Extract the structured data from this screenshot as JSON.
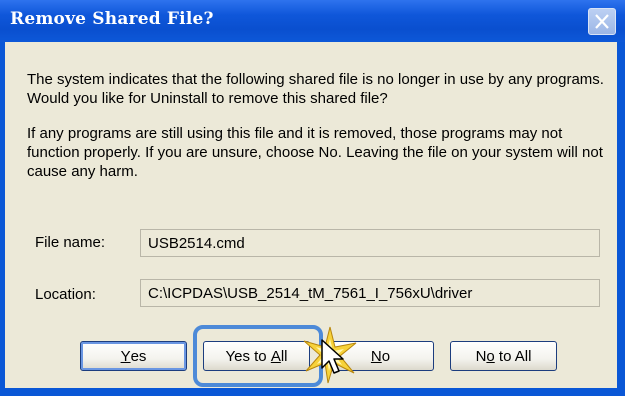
{
  "window": {
    "title": "Remove Shared File?",
    "close_icon": "close-icon"
  },
  "message": {
    "paragraph1": "The system indicates that the following shared file is no longer in use by any programs. Would you like for Uninstall to remove this shared file?",
    "paragraph2": "If any programs are still using this file and it is removed, those programs may not function properly. If you are unsure, choose No. Leaving the file on your system will not cause any harm."
  },
  "fields": {
    "file_name_label": "File name:",
    "file_name_value": "USB2514.cmd",
    "location_label": "Location:",
    "location_value": "C:\\ICPDAS\\USB_2514_tM_7561_I_756xU\\driver"
  },
  "buttons": {
    "yes_pre": "",
    "yes_key": "Y",
    "yes_post": "es",
    "yes_all_pre": "Yes to ",
    "yes_all_key": "A",
    "yes_all_post": "ll",
    "no_pre": "",
    "no_key": "N",
    "no_post": "o",
    "no_all_pre": "N",
    "no_all_key": "o",
    "no_all_post": " to All"
  },
  "colors": {
    "titlebar": "#0a4fcf",
    "dialog_bg": "#ece9d8",
    "highlight": "#4d8ad8",
    "sparkle": "#f7d23a"
  }
}
